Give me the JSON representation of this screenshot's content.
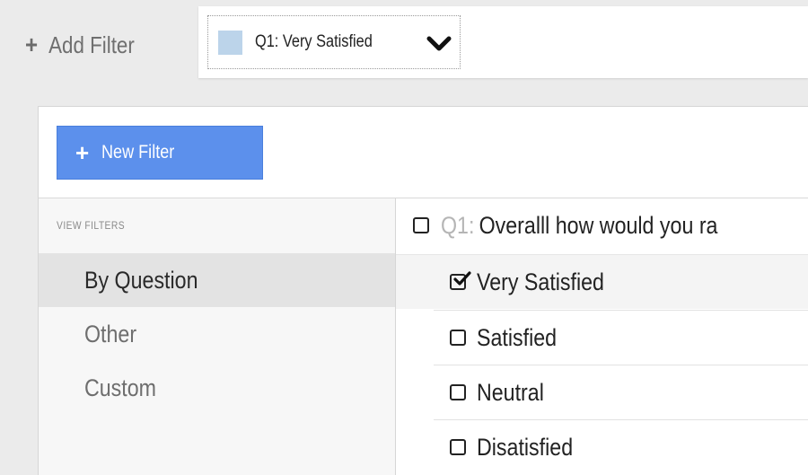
{
  "toolbar": {
    "add_filter_icon": "plus-icon",
    "add_filter_label": "Add Filter"
  },
  "active_filter": {
    "swatch_color": "#bcd4ea",
    "label": "Q1: Very Satisfied",
    "chevron_icon": "chevron-down-icon"
  },
  "panel": {
    "new_filter_icon": "plus-icon",
    "new_filter_label": "New Filter",
    "button_color": "#5c90ec"
  },
  "sidebar": {
    "heading": "VIEW FILTERS",
    "items": [
      {
        "label": "By Question",
        "active": true
      },
      {
        "label": "Other",
        "active": false
      },
      {
        "label": "Custom",
        "active": false
      }
    ]
  },
  "question": {
    "number": "Q1:",
    "title": "Overalll how would you ra",
    "checked": false
  },
  "options": [
    {
      "label": "Very Satisfied",
      "checked": true
    },
    {
      "label": "Satisfied",
      "checked": false
    },
    {
      "label": "Neutral",
      "checked": false
    },
    {
      "label": "Disatisfied",
      "checked": false
    }
  ]
}
